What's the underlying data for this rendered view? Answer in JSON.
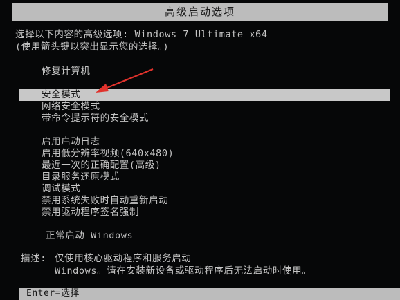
{
  "title": "高级启动选项",
  "intro": {
    "line1": "选择以下内容的高级选项: Windows 7 Ultimate x64",
    "line2": "(使用箭头键以突出显示您的选择。)"
  },
  "menu": {
    "repair": "修复计算机",
    "safe_mode": "安全模式",
    "safe_mode_networking": "网络安全模式",
    "safe_mode_cmd": "带命令提示符的安全模式",
    "boot_logging": "启用启动日志",
    "low_res_video": "启用低分辨率视频(640x480)",
    "last_known_good": "最近一次的正确配置(高级)",
    "ds_restore": "目录服务还原模式",
    "debugging": "调试模式",
    "disable_auto_restart": "禁用系统失败时自动重新启动",
    "disable_driver_sig": "禁用驱动程序签名强制",
    "start_normally": "正常启动 Windows"
  },
  "description": {
    "label": "描述:",
    "line1": "仅使用核心驱动程序和服务启动",
    "line2": "Windows。请在安装新设备或驱动程序后无法启动时使用。"
  },
  "footer": {
    "hint": "Enter=选择"
  },
  "colors": {
    "background": "#060708",
    "text": "#c4c4c4",
    "highlight": "#c8c8c8",
    "annotation_arrow": "#e0322c"
  }
}
